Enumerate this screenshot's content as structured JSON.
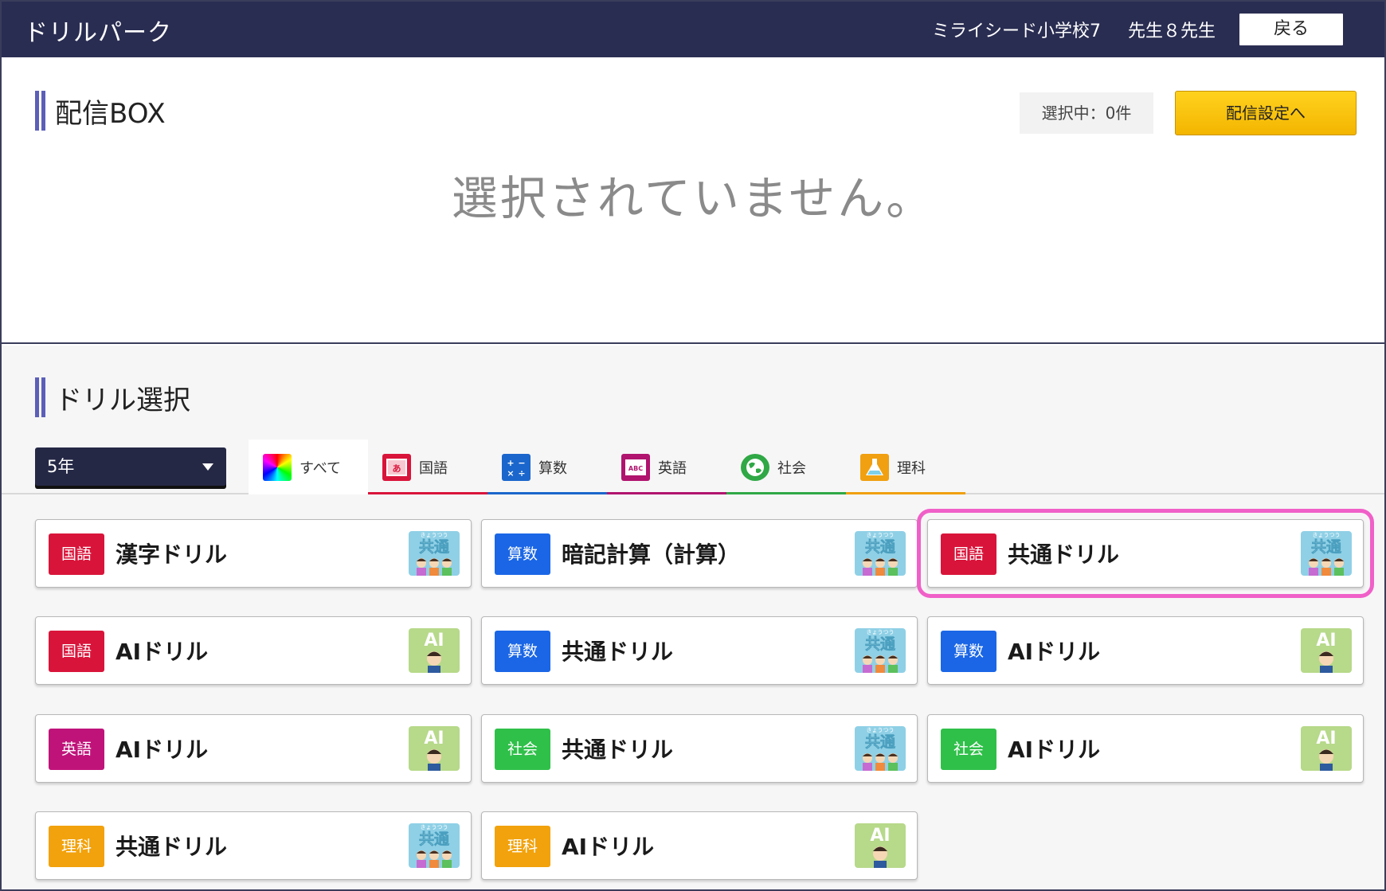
{
  "header": {
    "app_title": "ドリルパーク",
    "school": "ミライシード小学校7",
    "teacher": "先生８先生",
    "back_label": "戻る"
  },
  "box": {
    "title": "配信BOX",
    "selected_count": "選択中：0件",
    "config_label": "配信設定へ",
    "empty_message": "選択されていません。"
  },
  "drill": {
    "title": "ドリル選択",
    "grade": "5年",
    "tabs": [
      {
        "label": "すべて",
        "icon": "rainbow-icon",
        "color": "#ffffff"
      },
      {
        "label": "国語",
        "icon": "kokugo-book-icon",
        "color": "#d9143a"
      },
      {
        "label": "算数",
        "icon": "math-operators-icon",
        "color": "#1a66cc"
      },
      {
        "label": "英語",
        "icon": "abc-book-icon",
        "color": "#b0146e"
      },
      {
        "label": "社会",
        "icon": "globe-icon",
        "color": "#2fa845"
      },
      {
        "label": "理科",
        "icon": "flask-icon",
        "color": "#f0a010"
      }
    ],
    "cards": [
      {
        "subject": "国語",
        "name": "漢字ドリル",
        "kind": "共通",
        "color": "#d9143a"
      },
      {
        "subject": "算数",
        "name": "暗記計算（計算）",
        "kind": "共通",
        "color": "#1a66e6"
      },
      {
        "subject": "国語",
        "name": "共通ドリル",
        "kind": "共通",
        "color": "#d9143a"
      },
      {
        "subject": "国語",
        "name": "AIドリル",
        "kind": "AI",
        "color": "#d9143a"
      },
      {
        "subject": "算数",
        "name": "共通ドリル",
        "kind": "共通",
        "color": "#1a66e6"
      },
      {
        "subject": "算数",
        "name": "AIドリル",
        "kind": "AI",
        "color": "#1a66e6"
      },
      {
        "subject": "英語",
        "name": "AIドリル",
        "kind": "AI",
        "color": "#c0137a"
      },
      {
        "subject": "社会",
        "name": "共通ドリル",
        "kind": "共通",
        "color": "#2fc04a"
      },
      {
        "subject": "社会",
        "name": "AIドリル",
        "kind": "AI",
        "color": "#2fc04a"
      },
      {
        "subject": "理科",
        "name": "共通ドリル",
        "kind": "共通",
        "color": "#f2a20c"
      },
      {
        "subject": "理科",
        "name": "AIドリル",
        "kind": "AI",
        "color": "#f2a20c"
      }
    ],
    "kind_labels": {
      "kyotsu": "共通",
      "kyotsu_ruby": "きょうつう",
      "ai": "AI"
    }
  }
}
